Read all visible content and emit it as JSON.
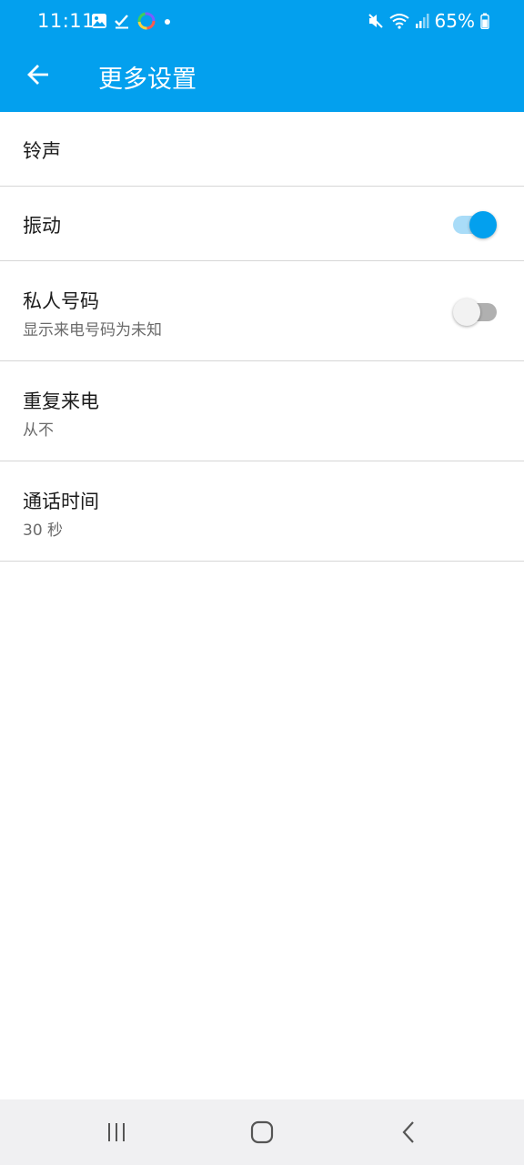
{
  "status_bar": {
    "time": "11:11",
    "battery": "65%",
    "left_icons": [
      "gallery-icon",
      "check-icon",
      "app-ring-icon",
      "dot-icon"
    ],
    "right_icons": [
      "mute-icon",
      "wifi-icon",
      "signal-icon",
      "battery-icon"
    ]
  },
  "toolbar": {
    "title": "更多设置",
    "back_icon": "arrow-left-icon"
  },
  "settings": {
    "ringtone": {
      "title": "铃声"
    },
    "vibration": {
      "title": "振动",
      "enabled": true
    },
    "private_number": {
      "title": "私人号码",
      "subtitle": "显示来电号码为未知",
      "enabled": false
    },
    "repeat_call": {
      "title": "重复来电",
      "subtitle": "从不"
    },
    "call_time": {
      "title": "通话时间",
      "subtitle": "30 秒"
    }
  },
  "nav_bar": {
    "buttons": [
      "recents-icon",
      "home-icon",
      "back-icon"
    ]
  },
  "colors": {
    "accent": "#03a0ee",
    "switch_track_on": "#a9dcf8",
    "switch_track_off": "#b0b0b0",
    "divider": "#d6d6d6",
    "nav_bg": "#f0f0f2"
  }
}
